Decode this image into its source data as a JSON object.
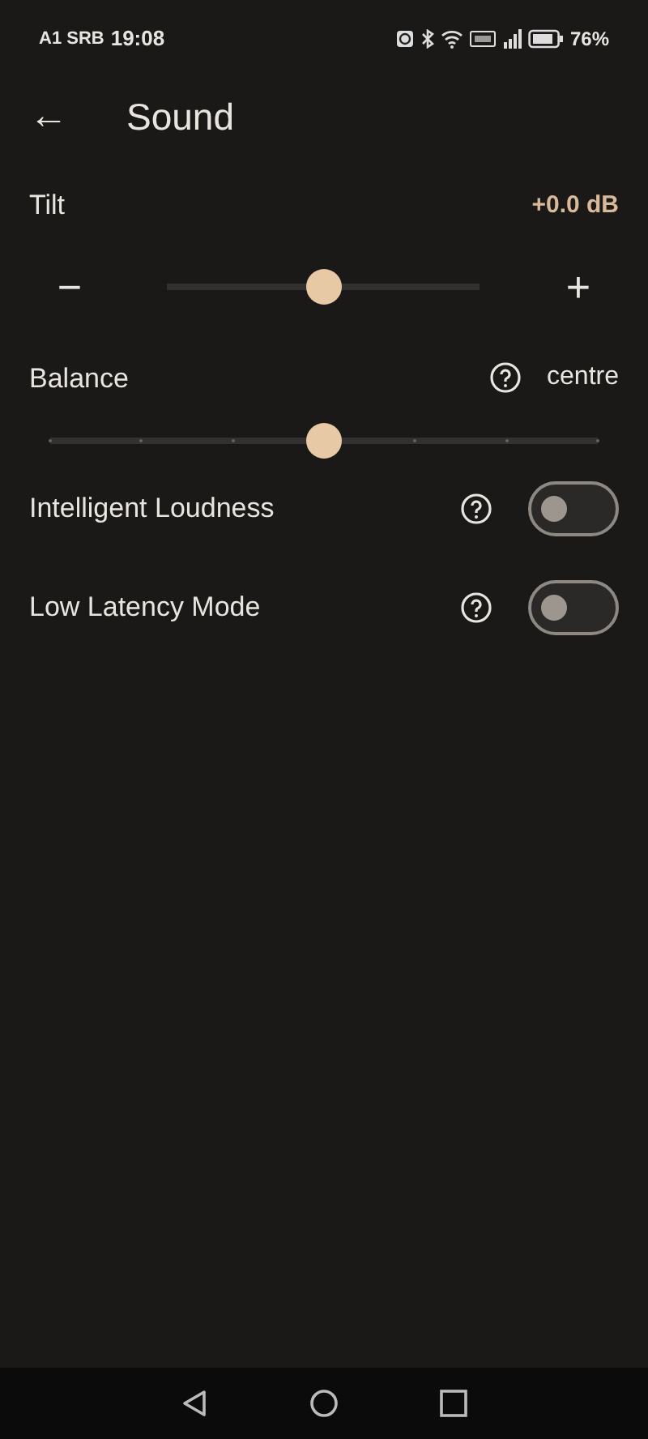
{
  "status_bar": {
    "carrier": "A1 SRB",
    "time": "19:08",
    "battery": "76%"
  },
  "header": {
    "back": "←",
    "title": "Sound"
  },
  "tilt": {
    "label": "Tilt",
    "reading": "+0.0 dB",
    "minus": "−",
    "plus": "+",
    "level": 0.5
  },
  "balance": {
    "label": "Balance",
    "reading": "centre",
    "level": 0.5
  },
  "toggles": [
    {
      "label": "Intelligent Loudness",
      "on": false
    },
    {
      "label": "Low Latency Mode",
      "on": false
    }
  ]
}
